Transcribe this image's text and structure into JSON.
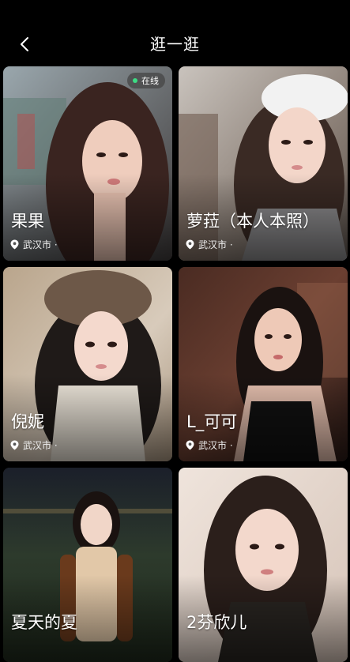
{
  "header": {
    "title": "逛一逛"
  },
  "online_label": "在线",
  "profiles": [
    {
      "name": "果果",
      "location": "武汉市 ·"
    },
    {
      "name": "萝菈（本人本照）",
      "location": "武汉市 ·"
    },
    {
      "name": "倪妮",
      "location": "武汉市 ·"
    },
    {
      "name": "L_可可",
      "location": "武汉市 ·"
    },
    {
      "name": "夏天的夏",
      "location": ""
    },
    {
      "name": "2芬欣儿",
      "location": ""
    }
  ],
  "icons": {
    "back": "chevron-left-icon",
    "location": "location-pin-icon",
    "online": "status-dot-icon"
  },
  "colors": {
    "background": "#000000",
    "online_dot": "#3ddc84",
    "text": "#ffffff"
  }
}
